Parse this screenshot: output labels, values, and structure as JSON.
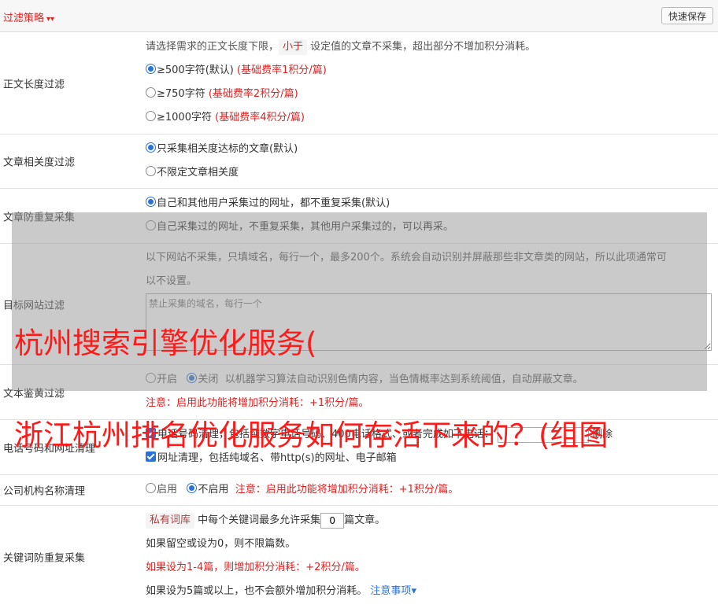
{
  "header": {
    "title": "过滤策略",
    "save_label": "快速保存"
  },
  "length_filter": {
    "label": "正文长度过滤",
    "desc_pre": "请选择需求的正文长度下限，",
    "desc_tag": "小于",
    "desc_post": "设定值的文章不采集，超出部分不增加积分消耗。",
    "options": [
      {
        "text": "≥500字符(默认)",
        "note": "(基础费率1积分/篇)",
        "checked": true
      },
      {
        "text": "≥750字符",
        "note": "(基础费率2积分/篇)",
        "checked": false
      },
      {
        "text": "≥1000字符",
        "note": "(基础费率4积分/篇)",
        "checked": false
      }
    ]
  },
  "relevance": {
    "label": "文章相关度过滤",
    "options": [
      {
        "text": "只采集相关度达标的文章(默认)",
        "checked": true
      },
      {
        "text": "不限定文章相关度",
        "checked": false
      }
    ]
  },
  "dedupe": {
    "label": "文章防重复采集",
    "options": [
      {
        "text": "自己和其他用户采集过的网址，都不重复采集(默认)",
        "checked": true
      },
      {
        "text": "自己采集过的网址，不重复采集，其他用户采集过的，可以再采。",
        "checked": false
      }
    ]
  },
  "site_filter": {
    "label": "目标网站过滤",
    "desc_line1": "以下网站不采集，只填域名，每行一个，最多200个。系统会自动识别并屏蔽那些非文章类的网站，所以此项通常可",
    "desc_line2": "以不设置。",
    "placeholder": "禁止采集的域名，每行一个"
  },
  "porn_filter": {
    "label": "文本鉴黄过滤",
    "on_label": "开启",
    "off_label": "关闭",
    "desc": "以机器学习算法自动识别色情内容，当色情概率达到系统阈值，自动屏蔽文章。",
    "note": "注意：启用此功能将增加积分消耗：+1积分/篇。"
  },
  "contact_clean": {
    "label": "电话号码和网址清理",
    "phone_text": "电话号码清理，包括纯数字电话号码、400电话格式、或者完成如下电话：",
    "phone_value": "",
    "phone_suffix": "删除",
    "url_text": "网址清理，包括纯域名、带http(s)的网址、电子邮箱"
  },
  "org_clean": {
    "label": "公司机构名称清理",
    "on_label": "启用",
    "off_label": "不启用",
    "note": "注意：启用此功能将增加积分消耗：+1积分/篇。"
  },
  "keyword_dedupe": {
    "label": "关键词防重复采集",
    "tag": "私有词库",
    "line1_pre": "中每个关键词最多允许采集",
    "value": "0",
    "line1_post": "篇文章。",
    "line2": "如果留空或设为0，则不限篇数。",
    "line3": "如果设为1-4篇，则增加积分消耗：+2积分/篇。",
    "line4": "如果设为5篇或以上，也不会额外增加积分消耗。",
    "notice_link": "注意事项"
  },
  "watermark": {
    "line1": "杭州搜索引擎优化服务(",
    "line2": "浙江杭州排名优化服务如何存活下来的？(组图"
  }
}
